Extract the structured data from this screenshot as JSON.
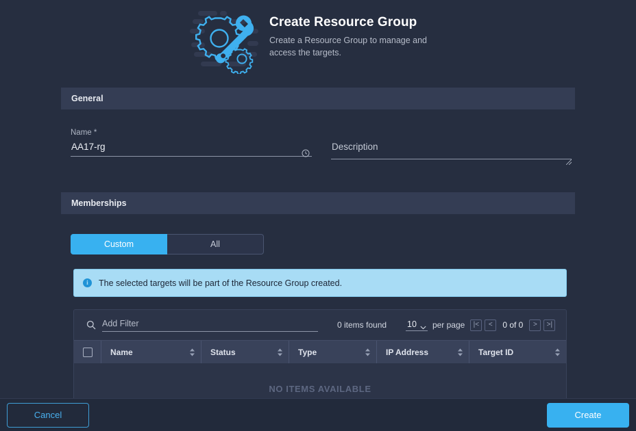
{
  "header": {
    "icon": "gear-wrench-icon",
    "title": "Create Resource Group",
    "subtitle": "Create a Resource Group to manage and access the targets."
  },
  "sections": {
    "general": {
      "title": "General",
      "name_label": "Name *",
      "name_value": "AA17-rg",
      "name_history_icon": "history-icon",
      "description_placeholder": "Description",
      "description_value": ""
    },
    "memberships": {
      "title": "Memberships",
      "toggle": {
        "options": [
          "Custom",
          "All"
        ],
        "selected": "Custom"
      },
      "info_banner": {
        "icon": "info-icon",
        "text": "The selected targets will be part of the Resource Group created."
      }
    }
  },
  "table": {
    "search_icon": "search-icon",
    "filter_placeholder": "Add Filter",
    "filter_value": "",
    "items_found": "0 items found",
    "per_page_value": "10",
    "per_page_label": "per page",
    "pager": {
      "first_label": "|<",
      "prev_label": "<",
      "count_label": "0 of 0",
      "next_label": ">",
      "last_label": ">|"
    },
    "settings_icon": "gear-icon",
    "columns": [
      {
        "label": "Name"
      },
      {
        "label": "Status"
      },
      {
        "label": "Type"
      },
      {
        "label": "IP Address"
      },
      {
        "label": "Target ID"
      }
    ],
    "select_all_checkbox": false,
    "rows": [],
    "empty_text": "NO ITEMS AVAILABLE"
  },
  "footer": {
    "cancel_label": "Cancel",
    "create_label": "Create"
  },
  "colors": {
    "page_background": "#262e40",
    "section_bar": "#343d54",
    "accent": "#38b1f0",
    "info_banner_background": "#a8dcf5",
    "table_background": "#2c3448",
    "table_header": "#39425a",
    "footer_background": "#222a3b"
  }
}
